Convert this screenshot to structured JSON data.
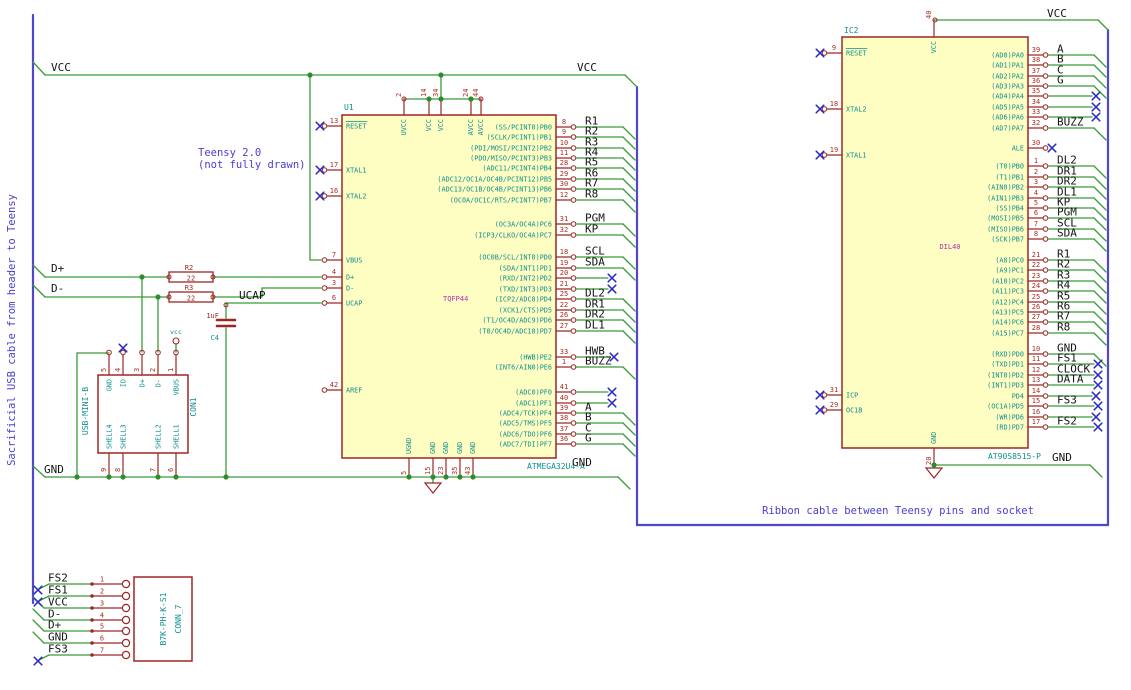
{
  "notes": {
    "left_cable": "Sacrificial USB cable from header to Teensy",
    "teensy_line1": "Teensy 2.0",
    "teensy_line2": "(not fully drawn)",
    "ribbon": "Ribbon cable between Teensy pins and socket"
  },
  "net_labels": {
    "vcc_left": "VCC",
    "vcc_mid": "VCC",
    "vcc_right": "VCC",
    "gnd_left": "GND",
    "gnd_mid": "GND",
    "gnd_right": "GND",
    "d_plus": "D+",
    "d_minus": "D-",
    "ucap": "UCAP"
  },
  "power": {
    "vcc_small": "vcc"
  },
  "r2": {
    "ref": "R2",
    "value": "22"
  },
  "r3": {
    "ref": "R3",
    "value": "22"
  },
  "c4": {
    "ref": "C4",
    "value": "1uF"
  },
  "con1": {
    "ref": "CON1",
    "part": "USB-MINI-B",
    "top_pins": [
      {
        "n": "5",
        "name": "GND"
      },
      {
        "n": "4",
        "name": "ID",
        "nc": true
      },
      {
        "n": "3",
        "name": "D+"
      },
      {
        "n": "2",
        "name": "D-"
      },
      {
        "n": "1",
        "name": "VBUS"
      }
    ],
    "bottom_pins": [
      {
        "n": "9",
        "name": "SHELL4"
      },
      {
        "n": "8",
        "name": "SHELL3"
      },
      {
        "n": "7",
        "name": "SHELL2"
      },
      {
        "n": "6",
        "name": "SHELL1"
      }
    ]
  },
  "conn7": {
    "ref": "CONN_7",
    "part": "B7K-PH-K-S1",
    "pins": [
      {
        "n": "1",
        "label": "FS2",
        "nc": true
      },
      {
        "n": "2",
        "label": "FS1",
        "nc": true
      },
      {
        "n": "3",
        "label": "VCC"
      },
      {
        "n": "4",
        "label": "D-"
      },
      {
        "n": "5",
        "label": "D+"
      },
      {
        "n": "6",
        "label": "GND"
      },
      {
        "n": "7",
        "label": "FS3",
        "nc": true
      }
    ]
  },
  "u1": {
    "ref": "U1",
    "part": "ATMEGA32U4-A",
    "footprint": "TQFP44",
    "left_pins": [
      {
        "n": "13",
        "name": "RESET",
        "bar": true,
        "conn": "nc"
      },
      {
        "n": "17",
        "name": "XTAL1",
        "conn": "nc"
      },
      {
        "n": "16",
        "name": "XTAL2",
        "conn": "nc"
      },
      {
        "n": "7",
        "name": "VBUS",
        "conn": "wire"
      },
      {
        "n": "4",
        "name": "D+",
        "conn": "wire"
      },
      {
        "n": "3",
        "name": "D-",
        "conn": "wire"
      },
      {
        "n": "6",
        "name": "UCAP",
        "conn": "wire"
      },
      {
        "n": "42",
        "name": "AREF",
        "conn": "stub"
      }
    ],
    "top_pins": [
      {
        "n": "2",
        "name": "UVCC"
      },
      {
        "n": "14",
        "name": "VCC"
      },
      {
        "n": "34",
        "name": "VCC"
      },
      {
        "n": "24",
        "name": "AVCC"
      },
      {
        "n": "44",
        "name": "AVCC"
      }
    ],
    "bottom_pins": [
      {
        "n": "5",
        "name": "UGND"
      },
      {
        "n": "15",
        "name": "GND"
      },
      {
        "n": "23",
        "name": "GND"
      },
      {
        "n": "35",
        "name": "GND"
      },
      {
        "n": "43",
        "name": "GND"
      }
    ],
    "right_pins": [
      {
        "n": "8",
        "name": "(SS/PCINT0)PB0",
        "label": "R1",
        "conn": "bus"
      },
      {
        "n": "9",
        "name": "(SCLK/PCINT1)PB1",
        "label": "R2",
        "conn": "bus"
      },
      {
        "n": "10",
        "name": "(PDI/MOSI/PCINT2)PB2",
        "label": "R3",
        "conn": "bus"
      },
      {
        "n": "11",
        "name": "(PDO/MISO/PCINT3)PB3",
        "label": "R4",
        "conn": "bus"
      },
      {
        "n": "28",
        "name": "(ADC11/PCINT4)PB4",
        "label": "R5",
        "conn": "bus"
      },
      {
        "n": "29",
        "name": "(ADC12/OC1A/OC4B/PCINT12)PB5",
        "label": "R6",
        "conn": "bus"
      },
      {
        "n": "30",
        "name": "(ADC13/OC1B/OC4B/PCINT13)PB6",
        "label": "R7",
        "conn": "bus"
      },
      {
        "n": "12",
        "name": "(OC0A/OC1C/RTS/PCINT7)PB7",
        "label": "R8",
        "conn": "bus"
      },
      {
        "n": "31",
        "name": "(OC3A/OC4A)PC6",
        "label": "PGM",
        "conn": "bus"
      },
      {
        "n": "32",
        "name": "(ICP3/CLKO/OC4A)PC7",
        "label": "KP",
        "conn": "bus"
      },
      {
        "n": "18",
        "name": "(OC0B/SCL/INT0)PD0",
        "label": "SCL",
        "conn": "bus"
      },
      {
        "n": "19",
        "name": "(SDA/INT1)PD1",
        "label": "SDA",
        "conn": "bus"
      },
      {
        "n": "20",
        "name": "(RXD/INT2)PD2",
        "conn": "nc"
      },
      {
        "n": "21",
        "name": "(TXD/INT3)PD3",
        "conn": "nc"
      },
      {
        "n": "25",
        "name": "(ICP2/ADC8)PD4",
        "label": "DL2",
        "conn": "bus"
      },
      {
        "n": "22",
        "name": "(XCK1/CTS)PD5",
        "label": "DR1",
        "conn": "bus"
      },
      {
        "n": "26",
        "name": "(T1/OC4D/ADC9)PD6",
        "label": "DR2",
        "conn": "bus"
      },
      {
        "n": "27",
        "name": "(T0/OC4D/ADC10)PD7",
        "label": "DL1",
        "conn": "bus"
      },
      {
        "n": "33",
        "name": "(HWB)PE2",
        "label": "HWB",
        "conn": "label_nc"
      },
      {
        "n": "1",
        "name": "(INT6/AIN0)PE6",
        "label": "BUZZ",
        "conn": "bus"
      },
      {
        "n": "41",
        "name": "(ADC0)PF0",
        "conn": "nc"
      },
      {
        "n": "40",
        "name": "(ADC1)PF1",
        "conn": "nc"
      },
      {
        "n": "39",
        "name": "(ADC4/TCK)PF4",
        "label": "A",
        "conn": "bus"
      },
      {
        "n": "38",
        "name": "(ADC5/TMS)PF5",
        "label": "B",
        "conn": "bus"
      },
      {
        "n": "37",
        "name": "(ADC6/TDO)PF6",
        "label": "C",
        "conn": "bus"
      },
      {
        "n": "36",
        "name": "(ADC7/TDI)PF7",
        "label": "G",
        "conn": "bus"
      }
    ]
  },
  "ic2": {
    "ref": "IC2",
    "part": "AT90S8515-P",
    "footprint": "DIL40",
    "left_pins": [
      {
        "n": "9",
        "name": "RESET",
        "bar": true,
        "conn": "nc"
      },
      {
        "n": "18",
        "name": "XTAL2",
        "conn": "nc"
      },
      {
        "n": "19",
        "name": "XTAL1",
        "conn": "nc"
      },
      {
        "n": "31",
        "name": "ICP",
        "conn": "nc"
      },
      {
        "n": "29",
        "name": "OC1B",
        "conn": "nc"
      }
    ],
    "top_pins": [
      {
        "n": "40",
        "name": "VCC"
      }
    ],
    "bottom_pins": [
      {
        "n": "20",
        "name": "GND"
      }
    ],
    "right_pins": [
      {
        "n": "39",
        "name": "(AD0)PA0",
        "label": "A",
        "conn": "bus"
      },
      {
        "n": "38",
        "name": "(AD1)PA1",
        "label": "B",
        "conn": "bus"
      },
      {
        "n": "37",
        "name": "(AD2)PA2",
        "label": "C",
        "conn": "bus"
      },
      {
        "n": "36",
        "name": "(AD3)PA3",
        "label": "G",
        "conn": "bus"
      },
      {
        "n": "35",
        "name": "(AD4)PA4",
        "conn": "nc"
      },
      {
        "n": "34",
        "name": "(AD5)PA5",
        "conn": "nc"
      },
      {
        "n": "33",
        "name": "(AD6)PA6",
        "conn": "nc"
      },
      {
        "n": "32",
        "name": "(AD7)PA7",
        "label": "BUZZ",
        "conn": "bus"
      },
      {
        "n": "30",
        "name": "ALE",
        "conn": "nc_short"
      },
      {
        "n": "1",
        "name": "(T0)PB0",
        "label": "DL2",
        "conn": "bus"
      },
      {
        "n": "2",
        "name": "(T1)PB1",
        "label": "DR1",
        "conn": "bus"
      },
      {
        "n": "3",
        "name": "(AIN0)PB2",
        "label": "DR2",
        "conn": "bus"
      },
      {
        "n": "4",
        "name": "(AIN1)PB3",
        "label": "DL1",
        "conn": "bus"
      },
      {
        "n": "5",
        "name": "(SS)PB4",
        "label": "KP",
        "conn": "bus"
      },
      {
        "n": "6",
        "name": "(MOSI)PB5",
        "label": "PGM",
        "conn": "bus"
      },
      {
        "n": "7",
        "name": "(MISO)PB6",
        "label": "SCL",
        "conn": "bus"
      },
      {
        "n": "8",
        "name": "(SCK)PB7",
        "label": "SDA",
        "conn": "bus"
      },
      {
        "n": "21",
        "name": "(A8)PC0",
        "label": "R1",
        "conn": "bus"
      },
      {
        "n": "22",
        "name": "(A9)PC1",
        "label": "R2",
        "conn": "bus"
      },
      {
        "n": "23",
        "name": "(A10)PC2",
        "label": "R3",
        "conn": "bus"
      },
      {
        "n": "24",
        "name": "(A11)PC3",
        "label": "R4",
        "conn": "bus"
      },
      {
        "n": "25",
        "name": "(A12)PC4",
        "label": "R5",
        "conn": "bus"
      },
      {
        "n": "26",
        "name": "(A13)PC5",
        "label": "R6",
        "conn": "bus"
      },
      {
        "n": "27",
        "name": "(A14)PC6",
        "label": "R7",
        "conn": "bus"
      },
      {
        "n": "28",
        "name": "(A15)PC7",
        "label": "R8",
        "conn": "bus"
      },
      {
        "n": "10",
        "name": "(RXD)PD0",
        "label": "GND",
        "conn": "bus"
      },
      {
        "n": "11",
        "name": "(TXD)PD1",
        "label": "FS1",
        "conn": "label_nc"
      },
      {
        "n": "12",
        "name": "(INT0)PD2",
        "label": "CLOCK",
        "conn": "label_nc"
      },
      {
        "n": "13",
        "name": "(INT1)PD3",
        "label": "DATA",
        "conn": "label_nc"
      },
      {
        "n": "14",
        "name": "PD4",
        "conn": "nc"
      },
      {
        "n": "15",
        "name": "(OC1A)PD5",
        "label": "FS3",
        "conn": "label_nc"
      },
      {
        "n": "16",
        "name": "(WR)PD6",
        "conn": "nc"
      },
      {
        "n": "17",
        "name": "(RD)PD7",
        "label": "FS2",
        "conn": "label_nc"
      }
    ]
  },
  "colors": {
    "wire": "#3a9b37",
    "component": "#9e2724",
    "fill": "#fffec2",
    "pin_name": "#0e8f8f",
    "pin_number": "#ab2a1d",
    "label": "#141414",
    "note": "#4a3fd0",
    "cable": "#5047cd",
    "ref": "#0e8f8f",
    "footprint": "#b42fb4",
    "noconnect": "#2c2cc0",
    "junction": "#2e8b2e"
  }
}
